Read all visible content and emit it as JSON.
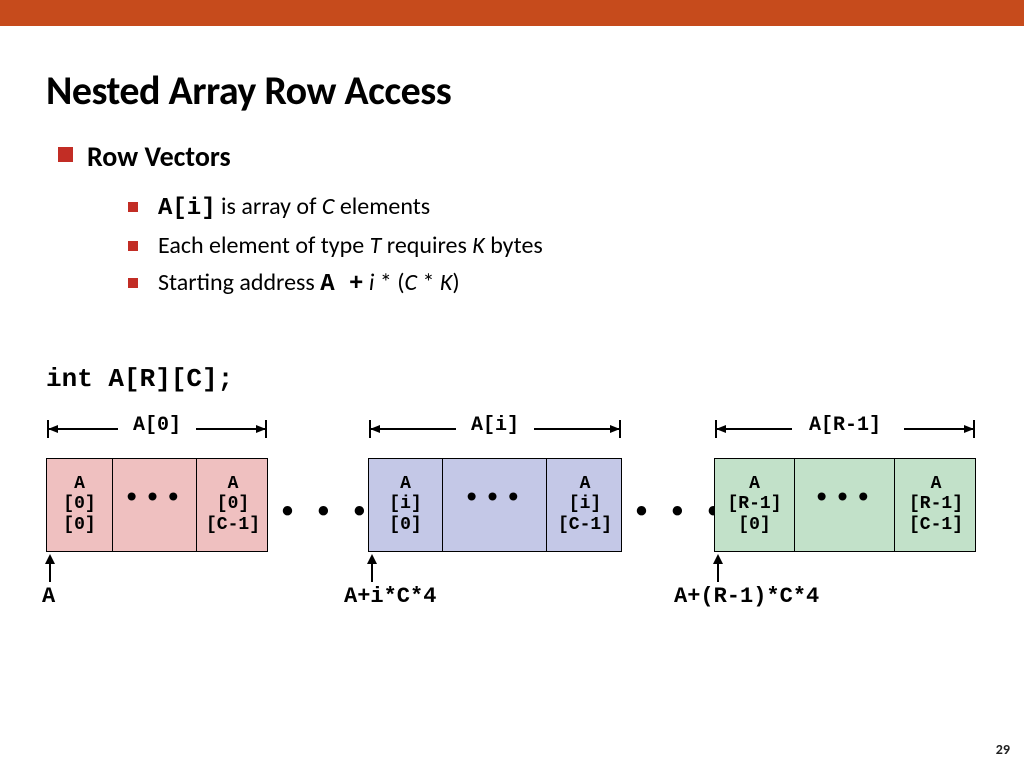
{
  "slide": {
    "title": "Nested Array Row Access",
    "heading": "Row Vectors",
    "bullets": {
      "b1_code": "A[i]",
      "b1_rest": " is array of ",
      "b1_ital": "C",
      "b1_tail": " elements",
      "b2_pre": "Each element of type ",
      "b2_T": "T",
      "b2_mid": " requires ",
      "b2_K": "K",
      "b2_tail": " bytes",
      "b3_pre": "Starting address ",
      "b3_code": "A +",
      "b3_sp": "  ",
      "b3_i": "i",
      "b3_mid": " * (",
      "b3_C": "C",
      "b3_mid2": " * ",
      "b3_K": "K",
      "b3_tail": ")"
    },
    "declaration": "int A[R][C];",
    "row_labels": {
      "r0": "A[0]",
      "r1": "A[i]",
      "r2": "A[R-1]"
    },
    "cells": {
      "r0c0": "A\n[0]\n[0]",
      "r0c1": "A\n[0]\n[C-1]",
      "r1c0": "A\n[i]\n[0]",
      "r1c1": "A\n[i]\n[C-1]",
      "r2c0": "A\n[R-1]\n[0]",
      "r2c1": "A\n[R-1]\n[C-1]",
      "dots": "•••"
    },
    "gap_dots": "•  •  •",
    "addresses": {
      "a0": "A",
      "a1": "A+i*C*4",
      "a2": "A+(R-1)*C*4"
    },
    "page_number": "29"
  }
}
